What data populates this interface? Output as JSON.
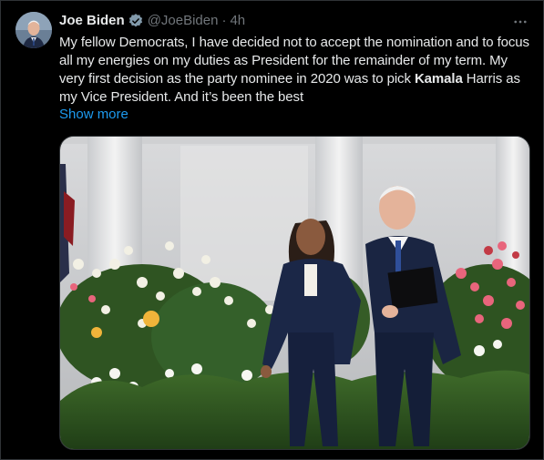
{
  "tweet": {
    "author_name": "Joe Biden",
    "author_handle": "@JoeBiden",
    "separator": "·",
    "timestamp": "4h",
    "text_part1": "My fellow Democrats, I have decided not to accept the nomination and to focus all my energies on my duties as President for the remainder of my term. My very first decision as the party nominee in 2020 was to pick ",
    "text_bold": "Kamala",
    "text_part2": " Harris as my Vice President. And it’s been the best",
    "show_more_label": "Show more",
    "verified_icon": "verified-badge-icon",
    "more_icon": "more-options-icon"
  },
  "colors": {
    "background": "#000000",
    "text_primary": "#e7e9ea",
    "text_secondary": "#71767b",
    "link": "#1d9bf0"
  }
}
